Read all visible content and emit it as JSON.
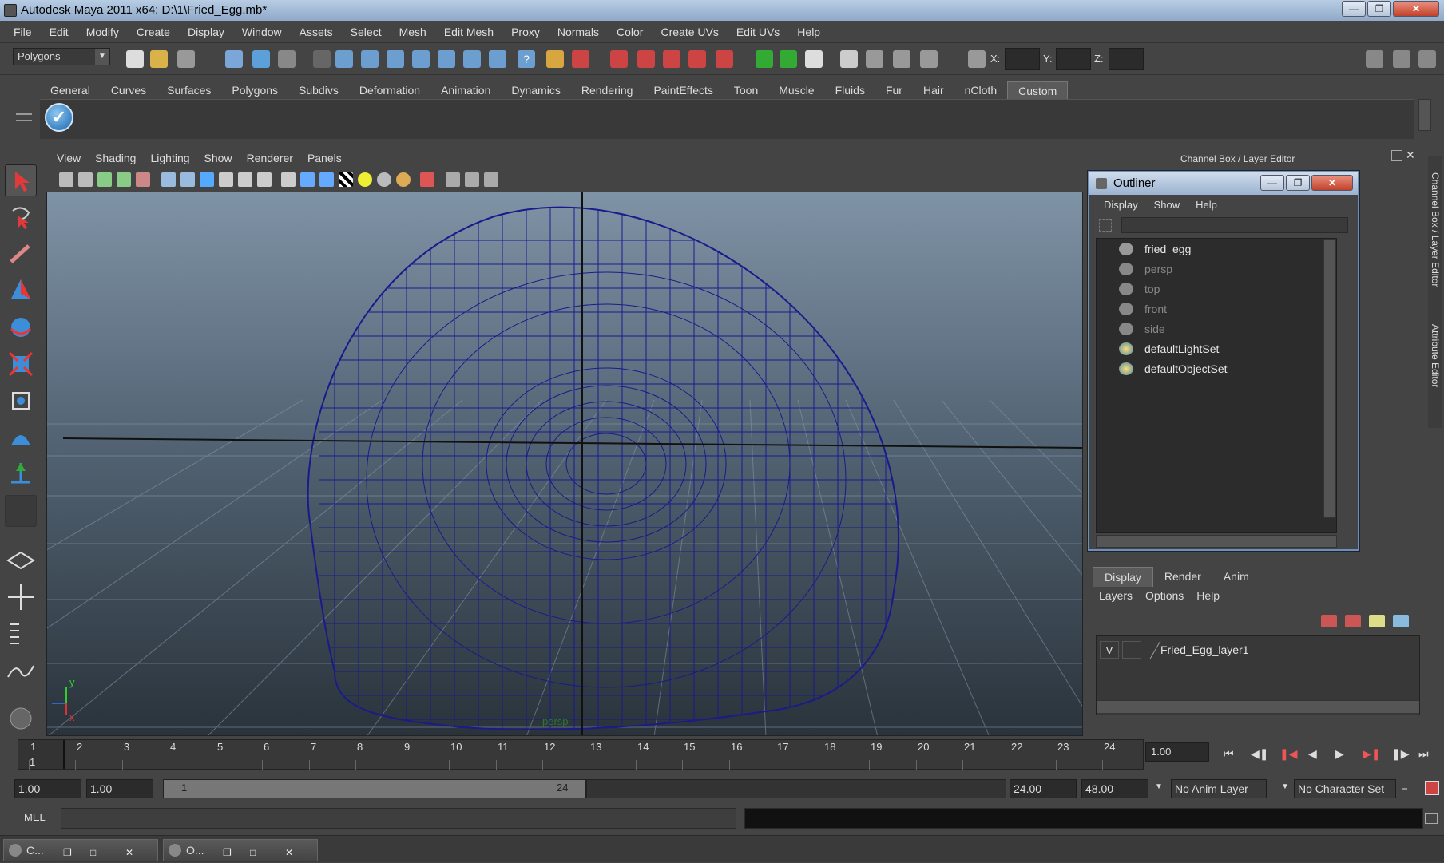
{
  "window": {
    "title": "Autodesk Maya 2011 x64: D:\\1\\Fried_Egg.mb*"
  },
  "menubar": [
    "File",
    "Edit",
    "Modify",
    "Create",
    "Display",
    "Window",
    "Assets",
    "Select",
    "Mesh",
    "Edit Mesh",
    "Proxy",
    "Normals",
    "Color",
    "Create UVs",
    "Edit UVs",
    "Help"
  ],
  "statusline": {
    "mode": "Polygons",
    "x_label": "X:",
    "y_label": "Y:",
    "z_label": "Z:"
  },
  "shelf": {
    "tabs": [
      "General",
      "Curves",
      "Surfaces",
      "Polygons",
      "Subdivs",
      "Deformation",
      "Animation",
      "Dynamics",
      "Rendering",
      "PaintEffects",
      "Toon",
      "Muscle",
      "Fluids",
      "Fur",
      "Hair",
      "nCloth",
      "Custom"
    ],
    "active": "Custom"
  },
  "viewport": {
    "menu": [
      "View",
      "Shading",
      "Lighting",
      "Show",
      "Renderer",
      "Panels"
    ],
    "camera_label": "persp",
    "axis_x": "x",
    "axis_y": "y"
  },
  "channelbox": {
    "title": "Channel Box / Layer Editor",
    "side_tabs": [
      "Channel Box / Layer Editor",
      "Attribute Editor"
    ]
  },
  "outliner": {
    "title": "Outliner",
    "menu": [
      "Display",
      "Show",
      "Help"
    ],
    "items": [
      {
        "name": "fried_egg",
        "dim": false
      },
      {
        "name": "persp",
        "dim": true
      },
      {
        "name": "top",
        "dim": true
      },
      {
        "name": "front",
        "dim": true
      },
      {
        "name": "side",
        "dim": true
      },
      {
        "name": "defaultLightSet",
        "dim": false
      },
      {
        "name": "defaultObjectSet",
        "dim": false
      }
    ]
  },
  "layers": {
    "tabs": [
      "Display",
      "Render",
      "Anim"
    ],
    "active": "Display",
    "menu": [
      "Layers",
      "Options",
      "Help"
    ],
    "row": {
      "visible": "V",
      "name": "Fried_Egg_layer1"
    }
  },
  "timeline": {
    "ticks": [
      "1",
      "2",
      "3",
      "4",
      "5",
      "6",
      "7",
      "8",
      "9",
      "10",
      "11",
      "12",
      "13",
      "14",
      "15",
      "16",
      "17",
      "18",
      "19",
      "20",
      "21",
      "22",
      "23",
      "24"
    ],
    "start_marker": "1",
    "current": "1.00"
  },
  "range": {
    "start": "1.00",
    "start2": "1.00",
    "bar_start": "1",
    "bar_end": "24",
    "end": "24.00",
    "end2": "48.00",
    "anim_layer": "No Anim Layer",
    "char_set": "No Character Set"
  },
  "cmdline": {
    "label": "MEL"
  },
  "taskbar": [
    {
      "label": "C..."
    },
    {
      "label": "O..."
    }
  ]
}
